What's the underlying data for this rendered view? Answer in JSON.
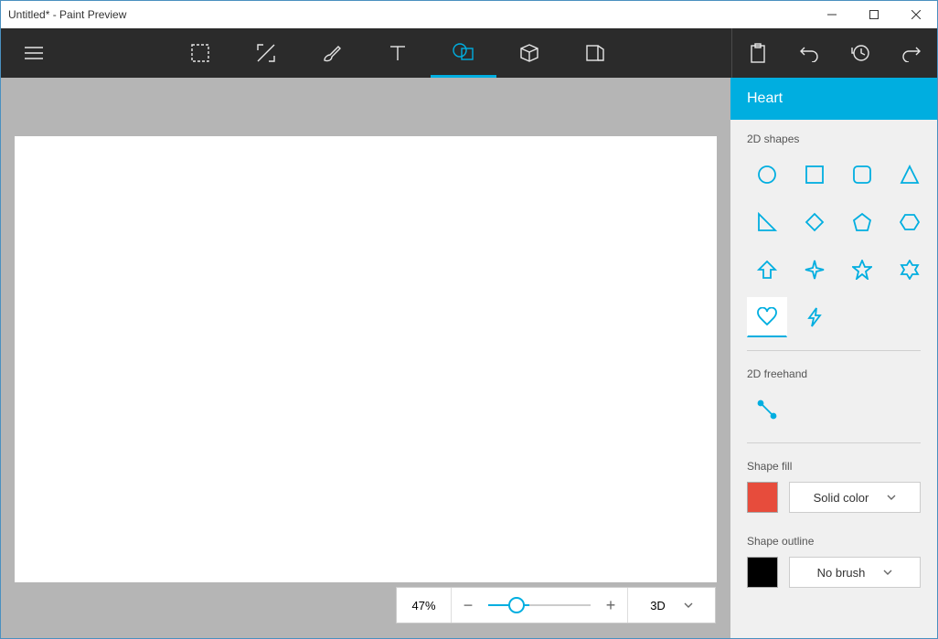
{
  "window": {
    "title": "Untitled* - Paint Preview"
  },
  "panel": {
    "header": "Heart",
    "shapes2d_title": "2D shapes",
    "freehand_title": "2D freehand",
    "shapefill_title": "Shape fill",
    "shapeoutline_title": "Shape outline",
    "fill_mode": "Solid color",
    "outline_mode": "No brush",
    "fill_color": "#e74c3c",
    "outline_color": "#000000"
  },
  "zoom": {
    "pct": "47%",
    "view_label": "3D"
  }
}
